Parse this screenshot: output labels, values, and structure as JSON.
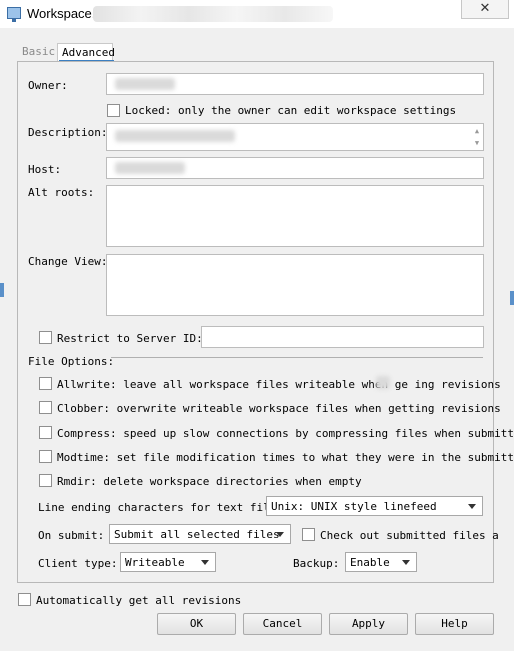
{
  "window": {
    "title": "Workspace.",
    "close_icon": "✕"
  },
  "tabs": [
    {
      "label": "Basic",
      "active": false
    },
    {
      "label": "Advanced",
      "active": true
    }
  ],
  "form": {
    "owner_label": "Owner:",
    "locked_label": "Locked: only the owner can edit workspace settings",
    "description_label": "Description:",
    "host_label": "Host:",
    "alt_roots_label": "Alt roots:",
    "change_view_label": "Change View:",
    "restrict_label": "Restrict to Server ID:",
    "file_options_label": "File Options:"
  },
  "file_options": [
    {
      "label": "Allwrite: leave all workspace files writeable when ge  ing revisions",
      "checked": false
    },
    {
      "label": "Clobber: overwrite writeable workspace files when getting revisions",
      "checked": false
    },
    {
      "label": "Compress: speed up slow connections by compressing files when submittin",
      "checked": false
    },
    {
      "label": "Modtime: set file modification times to what they were in the submitter",
      "checked": false
    },
    {
      "label": "Rmdir: delete workspace directories when empty",
      "checked": false
    }
  ],
  "line_ending": {
    "label": "Line ending characters for text file:",
    "value": "Unix: UNIX style linefeed"
  },
  "on_submit": {
    "label": "On submit:",
    "value": "Submit all selected files",
    "checkout_label": "Check out submitted files a"
  },
  "client_type": {
    "label": "Client type:",
    "value": "Writeable"
  },
  "backup": {
    "label": "Backup:",
    "value": "Enable"
  },
  "auto_get_label": "Automatically get all revisions",
  "buttons": {
    "ok": "OK",
    "cancel": "Cancel",
    "apply": "Apply",
    "help": "Help"
  }
}
